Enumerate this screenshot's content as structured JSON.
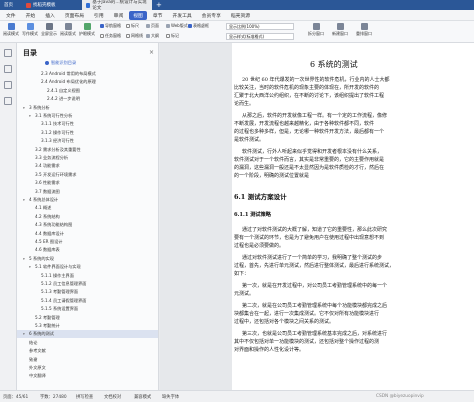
{
  "titlebar": {
    "tabs": [
      {
        "label": "首页",
        "active": false
      },
      {
        "label": "找稻壳模板",
        "active": false
      },
      {
        "label": "基于Java的...统设计与实现论文",
        "active": true
      }
    ]
  },
  "menubar": {
    "items": [
      "文件",
      "开始",
      "插入",
      "页面布局",
      "引用",
      "审阅",
      "视图",
      "章节",
      "开发工具",
      "会员专享",
      "稻壳资源"
    ],
    "active_index": 6
  },
  "ribbon": {
    "big_buttons": [
      "阅读模式",
      "写作模式",
      "全屏显示",
      "阅读版式",
      "护眼模式"
    ],
    "small_row1": [
      "导航窗格",
      "任务窗格",
      "标尺",
      "网格线"
    ],
    "small_row2": [
      "页面",
      "大纲",
      "Web版式"
    ],
    "check_row1": [
      "标记"
    ],
    "check_row2": [
      "表格虚框"
    ],
    "combo1": "显示比例(100%)",
    "combo2": "显示样式(标准格式)",
    "split_label": "拆分窗口",
    "new_window": "新建窗口",
    "arrange": "重排窗口"
  },
  "outline": {
    "title": "目录",
    "smart_label": "智能识别目录",
    "items": [
      {
        "text": "2.3 Android 常用的布局模式",
        "level": 3,
        "arrow": ""
      },
      {
        "text": "2.4 Android 布局优化的原理",
        "level": 3,
        "arrow": ""
      },
      {
        "text": "2.4.1 自定义视图",
        "level": 4,
        "arrow": ""
      },
      {
        "text": "2.4.2 进一步说明",
        "level": 4,
        "arrow": ""
      },
      {
        "text": "3 系统分析",
        "level": 1,
        "arrow": "▾"
      },
      {
        "text": "3.1 系统可行性分析",
        "level": 2,
        "arrow": "▾"
      },
      {
        "text": "3.1.1 技术可行性",
        "level": 3,
        "arrow": ""
      },
      {
        "text": "3.1.2 操作可行性",
        "level": 3,
        "arrow": ""
      },
      {
        "text": "3.1.3 经济可行性",
        "level": 3,
        "arrow": ""
      },
      {
        "text": "3.2 需求分析及其重要性",
        "level": 2,
        "arrow": ""
      },
      {
        "text": "3.3 业务流程分析",
        "level": 2,
        "arrow": ""
      },
      {
        "text": "3.4 功能需求",
        "level": 2,
        "arrow": ""
      },
      {
        "text": "3.5 开发运行环境需求",
        "level": 2,
        "arrow": ""
      },
      {
        "text": "3.6 性能需求",
        "level": 2,
        "arrow": ""
      },
      {
        "text": "3.7 数据流图",
        "level": 2,
        "arrow": ""
      },
      {
        "text": "4 系统总体设计",
        "level": 1,
        "arrow": "▾"
      },
      {
        "text": "4.1 概述",
        "level": 2,
        "arrow": ""
      },
      {
        "text": "4.2 系统结构",
        "level": 2,
        "arrow": ""
      },
      {
        "text": "4.3 系统功能结构图",
        "level": 2,
        "arrow": ""
      },
      {
        "text": "4.4 数据库设计",
        "level": 2,
        "arrow": ""
      },
      {
        "text": "4.5 ER 图设计",
        "level": 2,
        "arrow": ""
      },
      {
        "text": "4.6 数据库表",
        "level": 2,
        "arrow": ""
      },
      {
        "text": "5 系统的实现",
        "level": 1,
        "arrow": "▾"
      },
      {
        "text": "5.1 软件界面设计与实现",
        "level": 2,
        "arrow": "▾"
      },
      {
        "text": "5.1.1 操作主界面",
        "level": 3,
        "arrow": ""
      },
      {
        "text": "5.1.2 员工信息管理界面",
        "level": 3,
        "arrow": ""
      },
      {
        "text": "5.1.3 考勤管理界面",
        "level": 3,
        "arrow": ""
      },
      {
        "text": "5.1.4 员工请假管理界面",
        "level": 3,
        "arrow": ""
      },
      {
        "text": "5.1.5 系统设置界面",
        "level": 3,
        "arrow": ""
      },
      {
        "text": "5.2 考勤管理",
        "level": 2,
        "arrow": ""
      },
      {
        "text": "5.3 考勤统计",
        "level": 2,
        "arrow": ""
      },
      {
        "text": "6 系统的测试",
        "level": 1,
        "arrow": "▾",
        "selected": true
      },
      {
        "text": "结论",
        "level": 1,
        "arrow": ""
      },
      {
        "text": "参考文献",
        "level": 1,
        "arrow": ""
      },
      {
        "text": "致谢",
        "level": 1,
        "arrow": ""
      },
      {
        "text": "外文原文",
        "level": 1,
        "arrow": ""
      },
      {
        "text": "中文翻译",
        "level": 1,
        "arrow": ""
      }
    ]
  },
  "document": {
    "chapter": "6    系统的测试",
    "para1": [
      "20 世纪 60 年代爆发的一次世界性的软件危机，行业内的人士大都",
      "比较关注，当时的软件危机的现象主要的体现在，所开发的软件的",
      "汇聚于北大西洋公约组织，在不断的讨论下，该组织提出了软件工程",
      "论而生。"
    ],
    "para2": [
      "从那之后，软件的开发就像工程一样。有一个定的工作流程，像修",
      "不断发展，开发流程也越来越精化，由于各种软件都不同，软件",
      "的过程也多种多样，但是，无论哪一种软件开发方法，最后都有一个",
      "是软件测试。"
    ],
    "para3": [
      "软件测试，行外人听起来似乎觉得和开发者根本没有什么关系，",
      "软件测试对于一个软件而言，其实是非常重要的，它的主要作用就是",
      "的漏洞，这些漏洞一般还是不太显然因为是软件质检的才行，然后在",
      "的一个阶段，明确的测试位置就是"
    ],
    "h2": "6.1  测试方案设计",
    "h3": "6.1.1  测试策略",
    "para4": [
      "通过了对软件测试的大概了解，知道了它的重要性，那么此次研究",
      "要有一个测试的环节，也是为了避免用户在使用过程中出现意想不到",
      "过程也是必须要做的。"
    ],
    "para5": [
      "通过对软件测试进行了一个简单的学习，我明确了整个测试的步",
      "过程，首先，先进行单元测试，然后进行整体测试，最后进行系统测试，",
      "如下："
    ],
    "para6": [
      "第一次，就是在开发过程中，对公司员工考勤管理系统中的每一个",
      "元测试。"
    ],
    "para7": [
      "第二次，就是在公司员工考勤管理系统中每个功能模块都完成之后",
      "块都集合在一起，进行一次集成测试。它不仅对所有功能模块进行",
      "过程中，还包括对各个模块之间关系的测试。"
    ],
    "para8": [
      "第三次，也就是公司员工考勤管理系统基本完成之后，对系统进行",
      "其中不仅包括对单一功能模块的测试，还包括对整个操作过程的测",
      "对界面和操作的人性化设计等。"
    ]
  },
  "statusbar": {
    "page": "页面：45/61",
    "words": "字数：27480",
    "spell": "拼写检查",
    "doc_check": "文档校对",
    "proofread": "兼容模式",
    "missing_font": "缺失字体",
    "watermark": "CSDN @biyezuopinvip"
  },
  "colors": {
    "titlebar": "#2b5797",
    "active_menu": "#3a64c8",
    "outline_selected": "#dbe2f0"
  }
}
